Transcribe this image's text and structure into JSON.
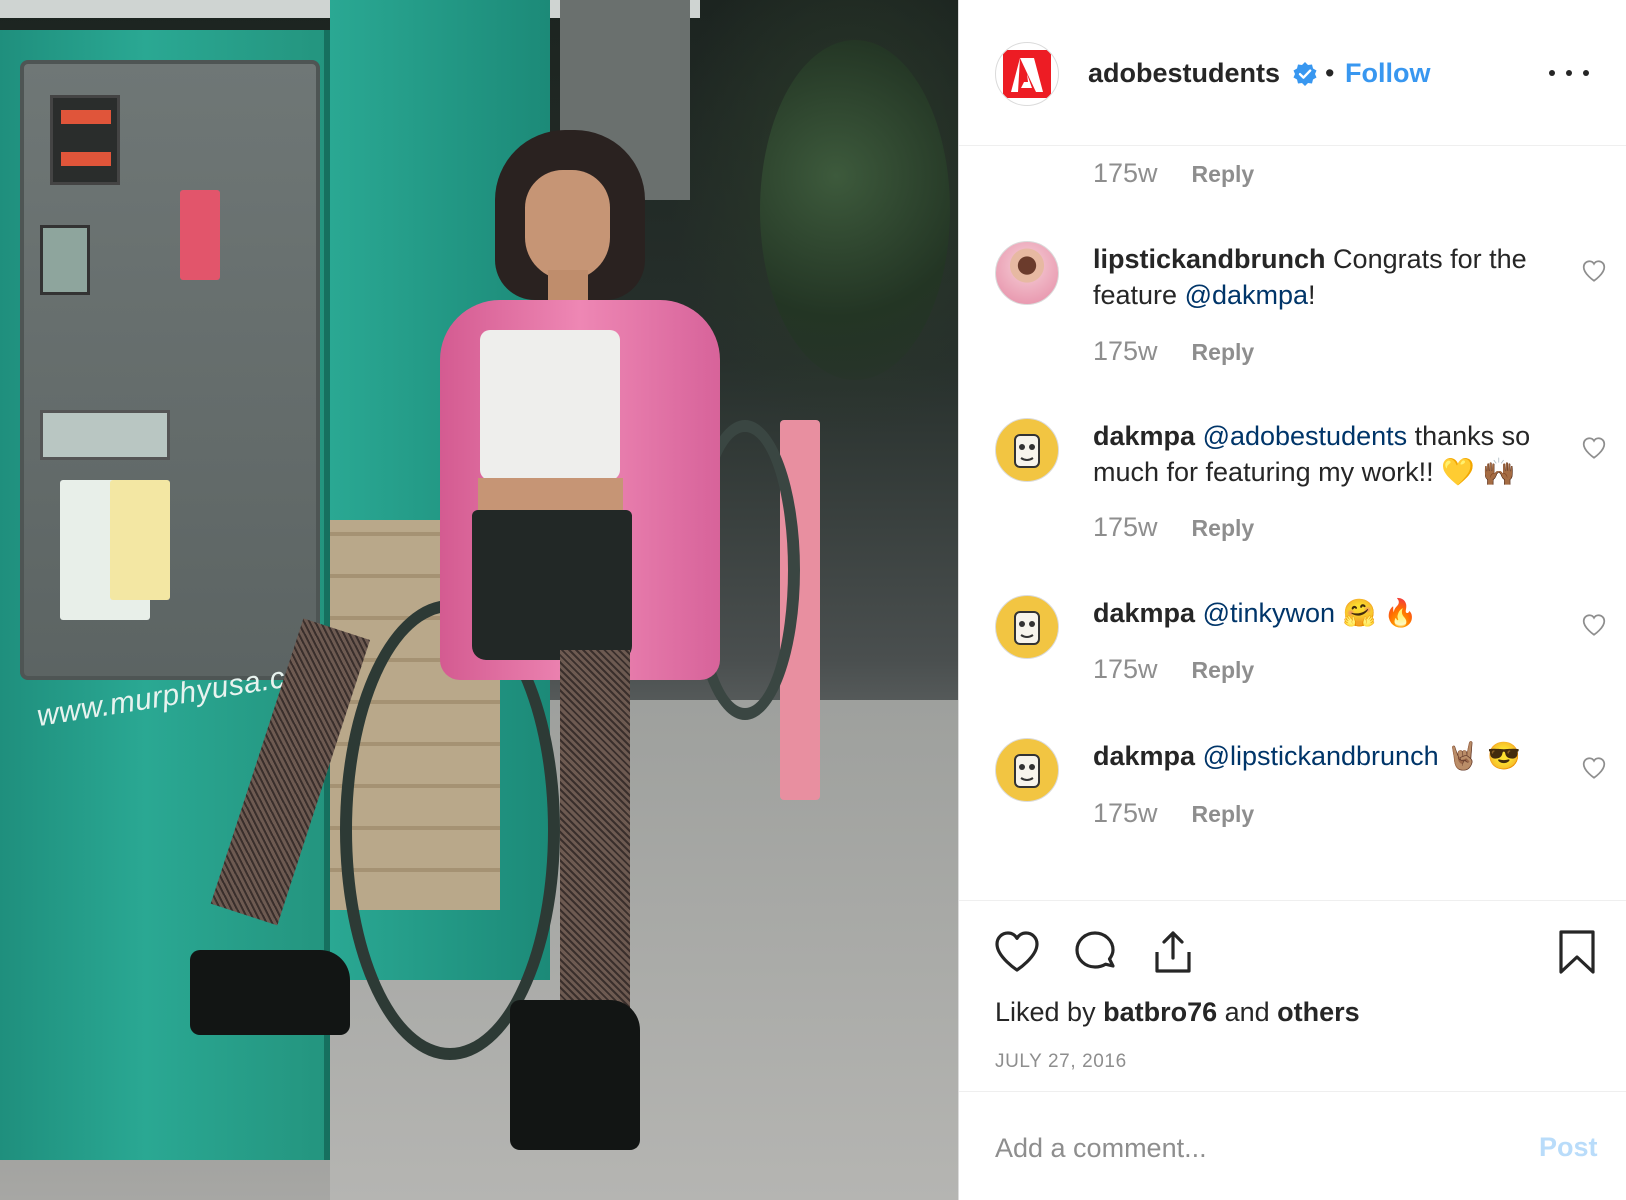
{
  "header": {
    "username": "adobestudents",
    "separator": "•",
    "follow_label": "Follow"
  },
  "photo": {
    "sign_text": "www.murphyusa.com"
  },
  "comments": {
    "top_meta": {
      "time": "175w",
      "reply": "Reply"
    },
    "items": [
      {
        "username": "lipstickandbrunch",
        "text_before": " Congrats for the feature ",
        "mention": "@dakmpa",
        "text_after": "!",
        "time": "175w",
        "reply": "Reply"
      },
      {
        "username": "dakmpa",
        "text_before": " ",
        "mention": "@adobestudents",
        "text_after": " thanks so much for featuring my work!! 💛 🙌🏾",
        "time": "175w",
        "reply": "Reply"
      },
      {
        "username": "dakmpa",
        "text_before": " ",
        "mention": "@tinkywon",
        "text_after": " 🤗 🔥",
        "time": "175w",
        "reply": "Reply"
      },
      {
        "username": "dakmpa",
        "text_before": " ",
        "mention": "@lipstickandbrunch",
        "text_after": " 🤘🏽 😎",
        "time": "175w",
        "reply": "Reply"
      }
    ]
  },
  "actions": {
    "liked_by_prefix": "Liked by ",
    "liked_by_user": "batbro76",
    "liked_by_mid": " and ",
    "liked_by_others": "others",
    "date": "JULY 27, 2016"
  },
  "comment_box": {
    "placeholder": "Add a comment...",
    "post_label": "Post"
  },
  "colors": {
    "link_blue": "#3897f0",
    "mention_blue": "#003569",
    "adobe_red": "#ed1c24",
    "muted_gray": "#8e8e8e"
  },
  "icons": [
    "verified-badge-icon",
    "more-options-icon",
    "like-heart-icon",
    "comment-bubble-icon",
    "share-icon",
    "bookmark-icon",
    "small-heart-icon"
  ]
}
